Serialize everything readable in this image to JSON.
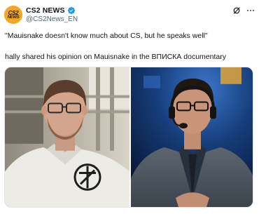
{
  "account": {
    "avatar_text_top": "CS2",
    "avatar_text_bottom": "NEWS",
    "display_name": "CS2 NEWS",
    "handle": "@CS2News_EN",
    "verified_color": "#1d9bf0"
  },
  "actions": {
    "grok_icon": "grok-icon",
    "more_icon": "more-icon"
  },
  "tweet": {
    "line1": "\"Mauisnake doesn't know much about CS, but he speaks well\"",
    "line2": "hally shared his opinion on Mauisnake in the ВПИСКА documentary"
  },
  "media": {
    "left_photo": "photo-man-glasses-white-tshirt",
    "right_photo": "photo-man-headset-suit-stage"
  }
}
